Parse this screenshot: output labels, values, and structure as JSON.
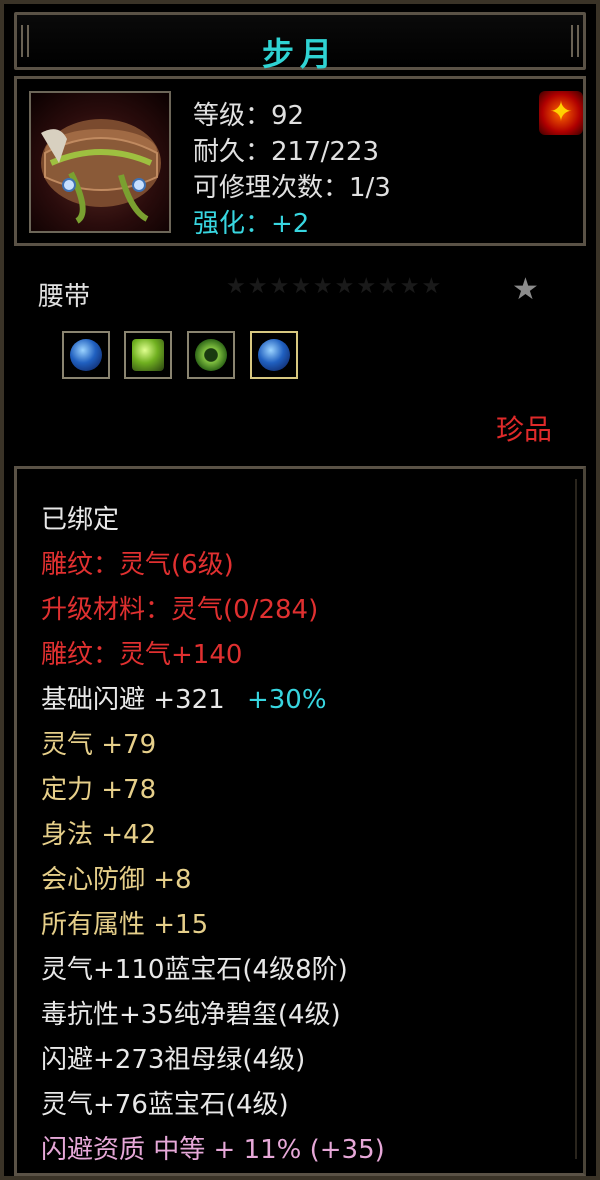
{
  "item": {
    "name": "步月",
    "level": "等级：92",
    "durability": "耐久：217/223",
    "repairs": "可修理次数：1/3",
    "enhance": "强化：+2",
    "type": "腰带",
    "quality": "珍品",
    "stars": "★★★★★★★★★★",
    "star_lit": "★",
    "sockets": [
      {
        "name": "sapphire-gem-icon"
      },
      {
        "name": "peridot-gem-icon"
      },
      {
        "name": "jade-ring-gem-icon"
      },
      {
        "name": "sapphire-gem-icon"
      }
    ]
  },
  "attributes": {
    "bound": "已绑定",
    "carve": "雕纹：灵气(6级)",
    "upgrade": "升级材料：灵气(0/284)",
    "carve_bonus": "雕纹：灵气+140",
    "base_dodge": "基础闪避  +321",
    "base_dodge_pct": "+30%",
    "spirit": "灵气  +79",
    "focus": "定力  +78",
    "agility": "身法  +42",
    "crit_def": "会心防御  +8",
    "all_attr": "所有属性  +15",
    "gem1": "灵气+110蓝宝石(4级8阶)",
    "gem2": "毒抗性+35纯净碧玺(4级)",
    "gem3": "闪避+273祖母绿(4级)",
    "gem4": "灵气+76蓝宝石(4级)",
    "aptitude": "闪避资质  中等  +  11%  (+35)"
  },
  "colors": {
    "title": "#2fd3d3",
    "red": "#e03030",
    "gold": "#e6cf8a",
    "cyan": "#38d6e0",
    "pink": "#e6a8d8"
  }
}
